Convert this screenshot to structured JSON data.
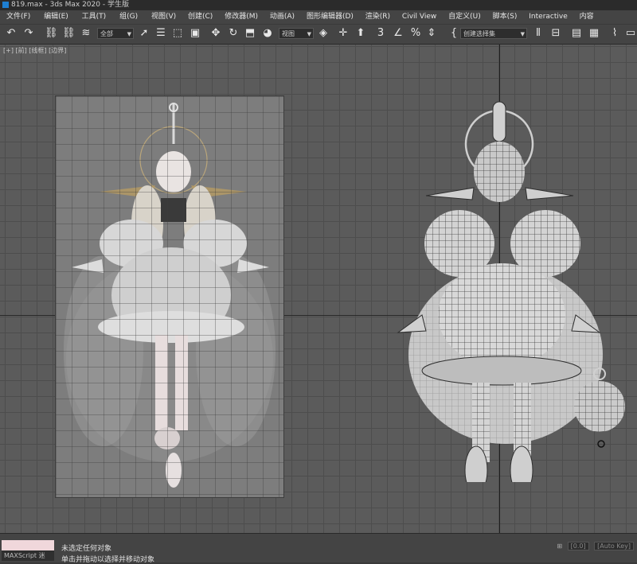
{
  "window": {
    "title": "819.max - 3ds Max 2020 - 学生版"
  },
  "menu": [
    "文件(F)",
    "编辑(E)",
    "工具(T)",
    "组(G)",
    "视图(V)",
    "创建(C)",
    "修改器(M)",
    "动画(A)",
    "图形编辑器(D)",
    "渲染(R)",
    "Civil View",
    "自定义(U)",
    "脚本(S)",
    "Interactive",
    "内容"
  ],
  "toolbar": {
    "selection_filter": "全部",
    "reference_coord": "视图",
    "named_selection": "创建选择集"
  },
  "viewport": {
    "labels": [
      "[+]",
      "[前]",
      "[线框]",
      "[边界]"
    ]
  },
  "status": {
    "maxscript_label": "MAXScript 迷",
    "line1": "未选定任何对象",
    "line2": "单击并拖动以选择并移动对象",
    "grid_value": "[0.0]",
    "zoom_value": "[Auto Key]"
  },
  "colors": {
    "viewport_bg": "#5b5b5b",
    "maxscript_field": "#f0d7db",
    "ui_panel": "#444444"
  }
}
